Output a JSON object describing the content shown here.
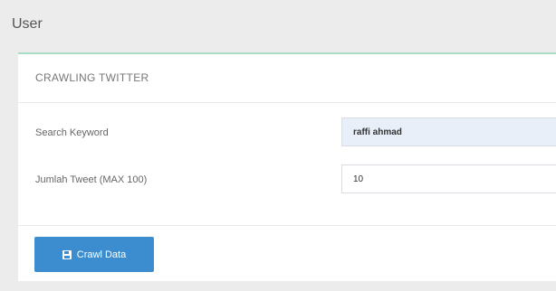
{
  "page": {
    "title": "User"
  },
  "panel": {
    "title": "CRAWLING TWITTER"
  },
  "form": {
    "keyword": {
      "label": "Search Keyword",
      "value": "raffi ahmad"
    },
    "jumlah": {
      "label": "Jumlah Tweet (MAX 100)",
      "value": "10"
    }
  },
  "actions": {
    "crawl_label": "Crawl Data",
    "crawl_icon": "save-icon"
  },
  "colors": {
    "accent": "#3c8dcf",
    "panel_top_border": "#a8dcc4",
    "input_filled_bg": "#e8eff9"
  }
}
